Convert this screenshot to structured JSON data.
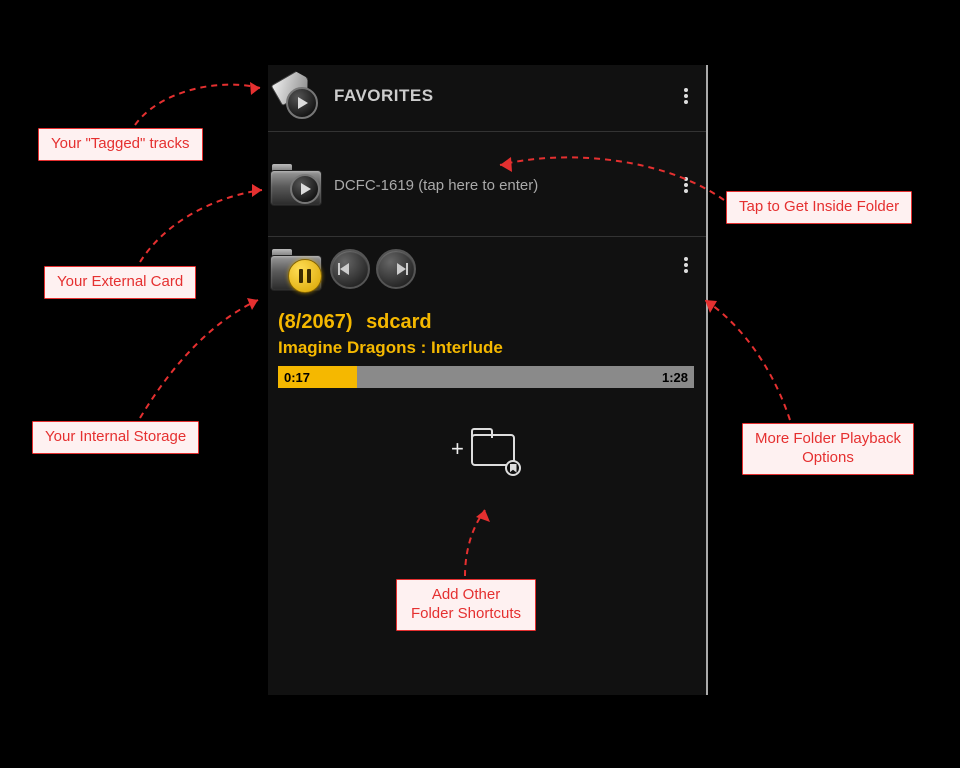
{
  "rows": {
    "favorites": {
      "label": "FAVORITES"
    },
    "folder1": {
      "label": "DCFC-1619 (tap here to enter)"
    }
  },
  "player": {
    "counter": "(8/2067)",
    "folder": "sdcard",
    "track": "Imagine Dragons : Interlude",
    "elapsed": "0:17",
    "total": "1:28",
    "progress_percent": 19
  },
  "callouts": {
    "tagged": "Your \"Tagged\" tracks",
    "external": "Your External Card",
    "internal": "Your Internal Storage",
    "tap_inside": "Tap to Get Inside Folder",
    "more_options": "More Folder Playback Options",
    "add_shortcuts": "Add Other Folder Shortcuts"
  }
}
